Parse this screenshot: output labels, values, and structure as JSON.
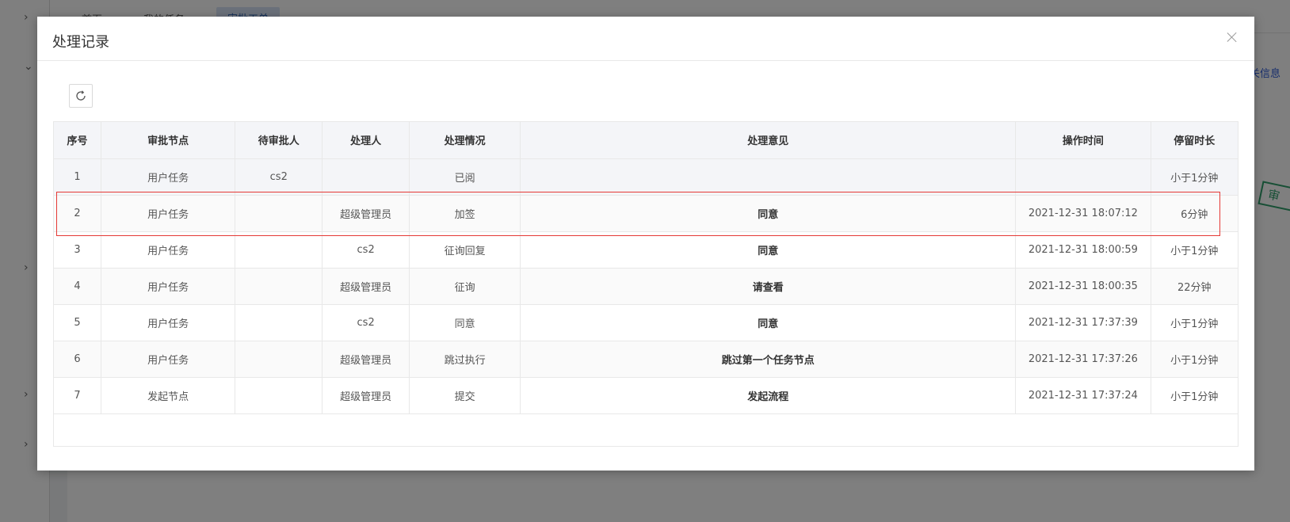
{
  "background": {
    "tabs": [
      "首页",
      "我的任务",
      "审批工单"
    ],
    "info_link": "关信息",
    "stamp_text": "审"
  },
  "modal": {
    "title": "处理记录",
    "refresh_icon": "refresh-icon",
    "close_icon": "close-icon"
  },
  "table": {
    "headers": [
      "序号",
      "审批节点",
      "待审批人",
      "处理人",
      "处理情况",
      "处理意见",
      "操作时间",
      "停留时长"
    ],
    "rows": [
      {
        "index": "1",
        "node": "用户任务",
        "pending": "cs2",
        "handler": "",
        "status": "已阅",
        "opinion": "",
        "time": "",
        "duration": "小于1分钟"
      },
      {
        "index": "2",
        "node": "用户任务",
        "pending": "",
        "handler": "超级管理员",
        "status": "加签",
        "opinion": "同意",
        "time": "2021-12-31 18:07:12",
        "duration": "6分钟"
      },
      {
        "index": "3",
        "node": "用户任务",
        "pending": "",
        "handler": "cs2",
        "status": "征询回复",
        "opinion": "同意",
        "time": "2021-12-31 18:00:59",
        "duration": "小于1分钟"
      },
      {
        "index": "4",
        "node": "用户任务",
        "pending": "",
        "handler": "超级管理员",
        "status": "征询",
        "opinion": "请查看",
        "time": "2021-12-31 18:00:35",
        "duration": "22分钟"
      },
      {
        "index": "5",
        "node": "用户任务",
        "pending": "",
        "handler": "cs2",
        "status": "同意",
        "opinion": "同意",
        "time": "2021-12-31 17:37:39",
        "duration": "小于1分钟"
      },
      {
        "index": "6",
        "node": "用户任务",
        "pending": "",
        "handler": "超级管理员",
        "status": "跳过执行",
        "opinion": "跳过第一个任务节点",
        "time": "2021-12-31 17:37:26",
        "duration": "小于1分钟"
      },
      {
        "index": "7",
        "node": "发起节点",
        "pending": "",
        "handler": "超级管理员",
        "status": "提交",
        "opinion": "发起流程",
        "time": "2021-12-31 17:37:24",
        "duration": "小于1分钟"
      }
    ]
  },
  "colors": {
    "highlight": "#e53935",
    "header_bg": "#f4f5f8"
  }
}
